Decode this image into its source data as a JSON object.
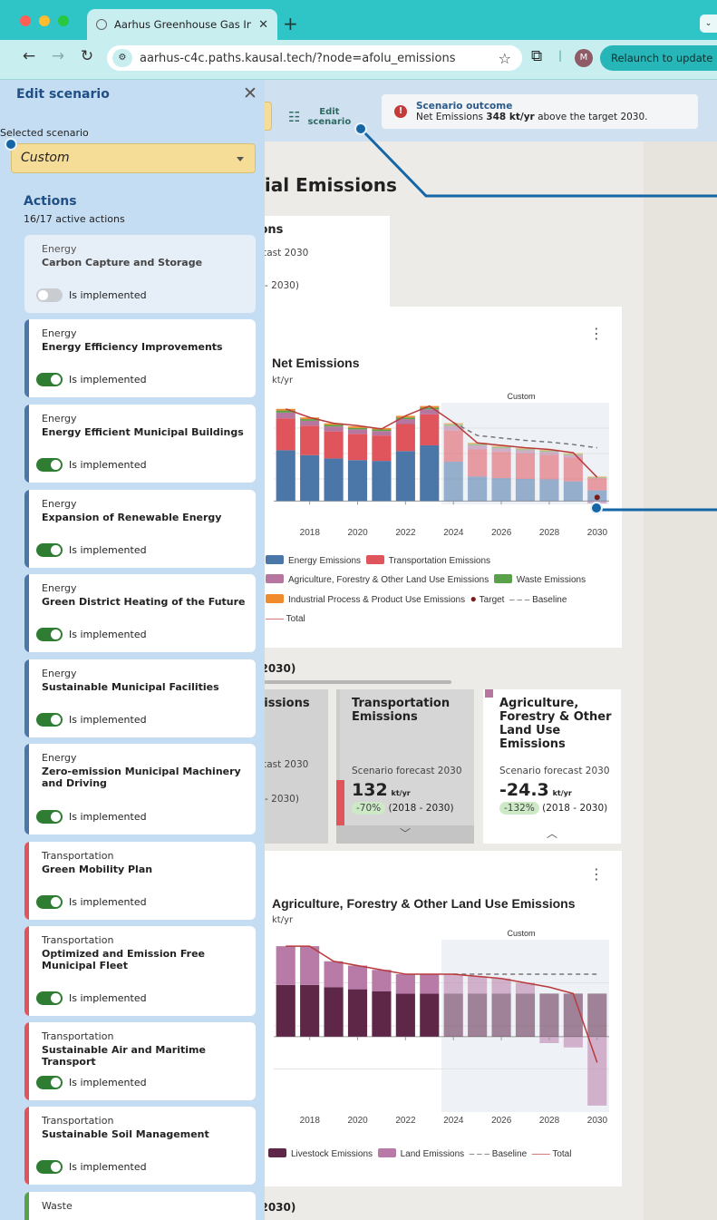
{
  "browser": {
    "tab_title": "Aarhus Greenhouse Gas Inven",
    "url": "aarhus-c4c.paths.kausal.tech/?node=afolu_emissions",
    "profile_initial": "M",
    "relaunch_label": "Relaunch to update"
  },
  "topbar": {
    "edit_label_1": "Edit",
    "edit_label_2": "scenario",
    "outcome_title": "Scenario outcome",
    "outcome_pre": "Net Emissions ",
    "outcome_value": "348 kt/yr",
    "outcome_post": " above the target 2030."
  },
  "sidebar": {
    "title": "Edit scenario",
    "selected_label": "Selected scenario",
    "selected_value": "Custom",
    "actions_heading": "Actions",
    "actions_count": "16/17 active actions",
    "toggle_label": "Is implemented",
    "items": [
      {
        "category": "Energy",
        "name": "Carbon Capture and Storage",
        "active": false
      },
      {
        "category": "Energy",
        "name": "Energy Efficiency Improvements",
        "active": true
      },
      {
        "category": "Energy",
        "name": "Energy Efficient Municipal Buildings",
        "active": true
      },
      {
        "category": "Energy",
        "name": "Expansion of Renewable Energy",
        "active": true
      },
      {
        "category": "Energy",
        "name": "Green District Heating of the Future",
        "active": true
      },
      {
        "category": "Energy",
        "name": "Sustainable Municipal Facilities",
        "active": true
      },
      {
        "category": "Energy",
        "name": "Zero-emission Municipal Machinery and Driving",
        "active": true
      },
      {
        "category": "Transportation",
        "name": "Green Mobility Plan",
        "active": true
      },
      {
        "category": "Transportation",
        "name": "Optimized and Emission Free Municipal Fleet",
        "active": true
      },
      {
        "category": "Transportation",
        "name": "Sustainable Air and Maritime Transport",
        "active": true
      },
      {
        "category": "Transportation",
        "name": "Sustainable Soil Management",
        "active": true
      },
      {
        "category": "Waste",
        "name": "",
        "active": true
      }
    ]
  },
  "main": {
    "heading": "rial Emissions",
    "summary_title": "ions",
    "summary_line1": "ecast 2030",
    "summary_line2": "8 - 2030)",
    "chart1_title": "Net Emissions",
    "chart1_unit": "kt/yr",
    "chart1_scenario": "Custom",
    "section1": "(2030)",
    "card_emissions_title": "nissions",
    "card_emissions_forecast": "ecast 2030",
    "card_emissions_range": "3 - 2030)",
    "card_transport_title": "Transportation Emissions",
    "card_transport_forecast": "Scenario forecast 2030",
    "card_transport_value": "132",
    "card_transport_unit": "kt/yr",
    "card_transport_change": "-70%",
    "card_transport_range": "(2018 - 2030)",
    "card_afolu_title": "Agriculture, Forestry & Other Land Use Emissions",
    "card_afolu_forecast": "Scenario forecast 2030",
    "card_afolu_value": "-24.3",
    "card_afolu_unit": "kt/yr",
    "card_afolu_change": "-132%",
    "card_afolu_range": "(2018 - 2030)",
    "chart2_title": "Agriculture, Forestry & Other Land Use Emissions",
    "chart2_unit": "kt/yr",
    "chart2_scenario": "Custom",
    "section2": "(2030)"
  },
  "colors": {
    "energy": "#4a76a8",
    "transport": "#e0545c",
    "afolu": "#b676a0",
    "waste": "#5aa24a",
    "industrial": "#f08b2c",
    "target": "#7a1c1c",
    "total": "#b83a3a",
    "livestock": "#5e2748",
    "land": "#b87aa6"
  },
  "chart_data": [
    {
      "type": "bar",
      "title": "Net Emissions",
      "ylabel": "kt/yr",
      "x": [
        2017,
        2018,
        2019,
        2020,
        2021,
        2022,
        2023,
        2024,
        2025,
        2026,
        2027,
        2028,
        2029,
        2030
      ],
      "x_ticks": [
        "2018",
        "2020",
        "2022",
        "2024",
        "2026",
        "2028",
        "2030"
      ],
      "forecast_label": "Custom",
      "forecast_start": 2024,
      "stacked": true,
      "series": [
        {
          "name": "Energy Emissions",
          "values": [
            620,
            560,
            520,
            500,
            490,
            610,
            680,
            480,
            300,
            280,
            270,
            265,
            240,
            130
          ]
        },
        {
          "name": "Transportation Emissions",
          "values": [
            390,
            360,
            330,
            320,
            310,
            330,
            380,
            380,
            330,
            320,
            310,
            300,
            290,
            150
          ]
        },
        {
          "name": "Agriculture, Forestry & Other Land Use Emissions",
          "values": [
            70,
            60,
            60,
            55,
            55,
            60,
            60,
            55,
            50,
            45,
            40,
            35,
            30,
            -30
          ]
        },
        {
          "name": "Waste Emissions",
          "values": [
            25,
            20,
            20,
            18,
            18,
            20,
            20,
            18,
            16,
            15,
            14,
            13,
            12,
            10
          ]
        },
        {
          "name": "Industrial Process & Product Use Emissions",
          "values": [
            20,
            20,
            18,
            18,
            18,
            20,
            20,
            18,
            16,
            15,
            14,
            13,
            12,
            10
          ]
        }
      ],
      "total": {
        "name": "Total",
        "values": [
          1125,
          1020,
          950,
          920,
          880,
          1040,
          1160,
          960,
          710,
          680,
          650,
          630,
          590,
          290
        ]
      },
      "baseline": {
        "name": "Baseline",
        "values": [
          null,
          null,
          null,
          null,
          null,
          null,
          null,
          960,
          800,
          770,
          740,
          720,
          690,
          650
        ]
      },
      "target": {
        "name": "Target",
        "x": 2030,
        "value": 0
      }
    },
    {
      "type": "bar",
      "title": "Agriculture, Forestry & Other Land Use Emissions",
      "ylabel": "kt/yr",
      "x": [
        2017,
        2018,
        2019,
        2020,
        2021,
        2022,
        2023,
        2024,
        2025,
        2026,
        2027,
        2028,
        2029,
        2030
      ],
      "x_ticks": [
        "2018",
        "2020",
        "2022",
        "2024",
        "2026",
        "2028",
        "2030"
      ],
      "forecast_label": "Custom",
      "forecast_start": 2024,
      "stacked": true,
      "series": [
        {
          "name": "Livestock Emissions",
          "values": [
            48,
            48,
            46,
            44,
            42,
            40,
            40,
            40,
            40,
            40,
            40,
            40,
            40,
            40
          ]
        },
        {
          "name": "Land Emissions",
          "values": [
            36,
            36,
            24,
            22,
            20,
            18,
            18,
            18,
            16,
            14,
            10,
            -6,
            -10,
            -64
          ]
        }
      ],
      "total": {
        "name": "Total",
        "values": [
          84,
          84,
          70,
          66,
          62,
          58,
          58,
          58,
          56,
          54,
          50,
          46,
          40,
          -24
        ]
      },
      "baseline": {
        "name": "Baseline",
        "values": [
          null,
          null,
          null,
          null,
          null,
          null,
          null,
          58,
          58,
          58,
          58,
          58,
          58,
          58
        ]
      }
    }
  ]
}
